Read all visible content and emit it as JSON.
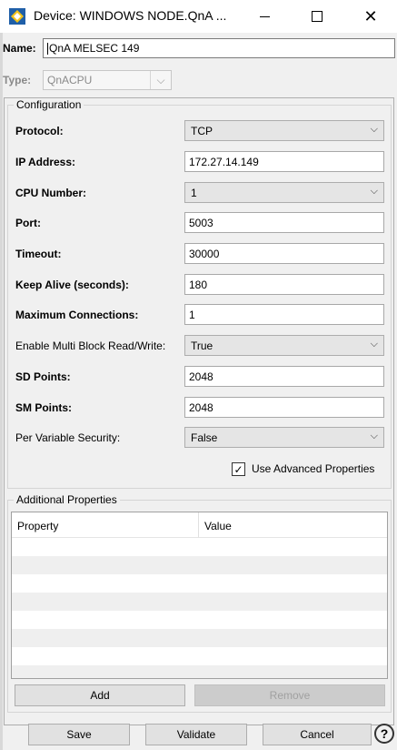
{
  "window": {
    "title": "Device: WINDOWS NODE.QnA ...",
    "icon": "device-app-icon"
  },
  "header": {
    "name_label": "Name:",
    "name_value": "QnA MELSEC 149",
    "type_label": "Type:",
    "type_value": "QnACPU"
  },
  "configuration": {
    "title": "Configuration",
    "protocol_label": "Protocol:",
    "protocol_value": "TCP",
    "ip_label": "IP Address:",
    "ip_value": "172.27.14.149",
    "cpu_label": "CPU Number:",
    "cpu_value": "1",
    "port_label": "Port:",
    "port_value": "5003",
    "timeout_label": "Timeout:",
    "timeout_value": "30000",
    "keepalive_label": "Keep Alive (seconds):",
    "keepalive_value": "180",
    "maxconn_label": "Maximum Connections:",
    "maxconn_value": "1",
    "multiblock_label": "Enable Multi Block Read/Write:",
    "multiblock_value": "True",
    "sd_label": "SD Points:",
    "sd_value": "2048",
    "sm_label": "SM Points:",
    "sm_value": "2048",
    "pervar_label": "Per Variable Security:",
    "pervar_value": "False",
    "advanced_label": "Use Advanced Properties",
    "advanced_checked": true
  },
  "additional": {
    "title": "Additional Properties",
    "col_property": "Property",
    "col_value": "Value",
    "add_label": "Add",
    "remove_label": "Remove"
  },
  "footer": {
    "save_label": "Save",
    "validate_label": "Validate",
    "cancel_label": "Cancel",
    "help_label": "?"
  }
}
